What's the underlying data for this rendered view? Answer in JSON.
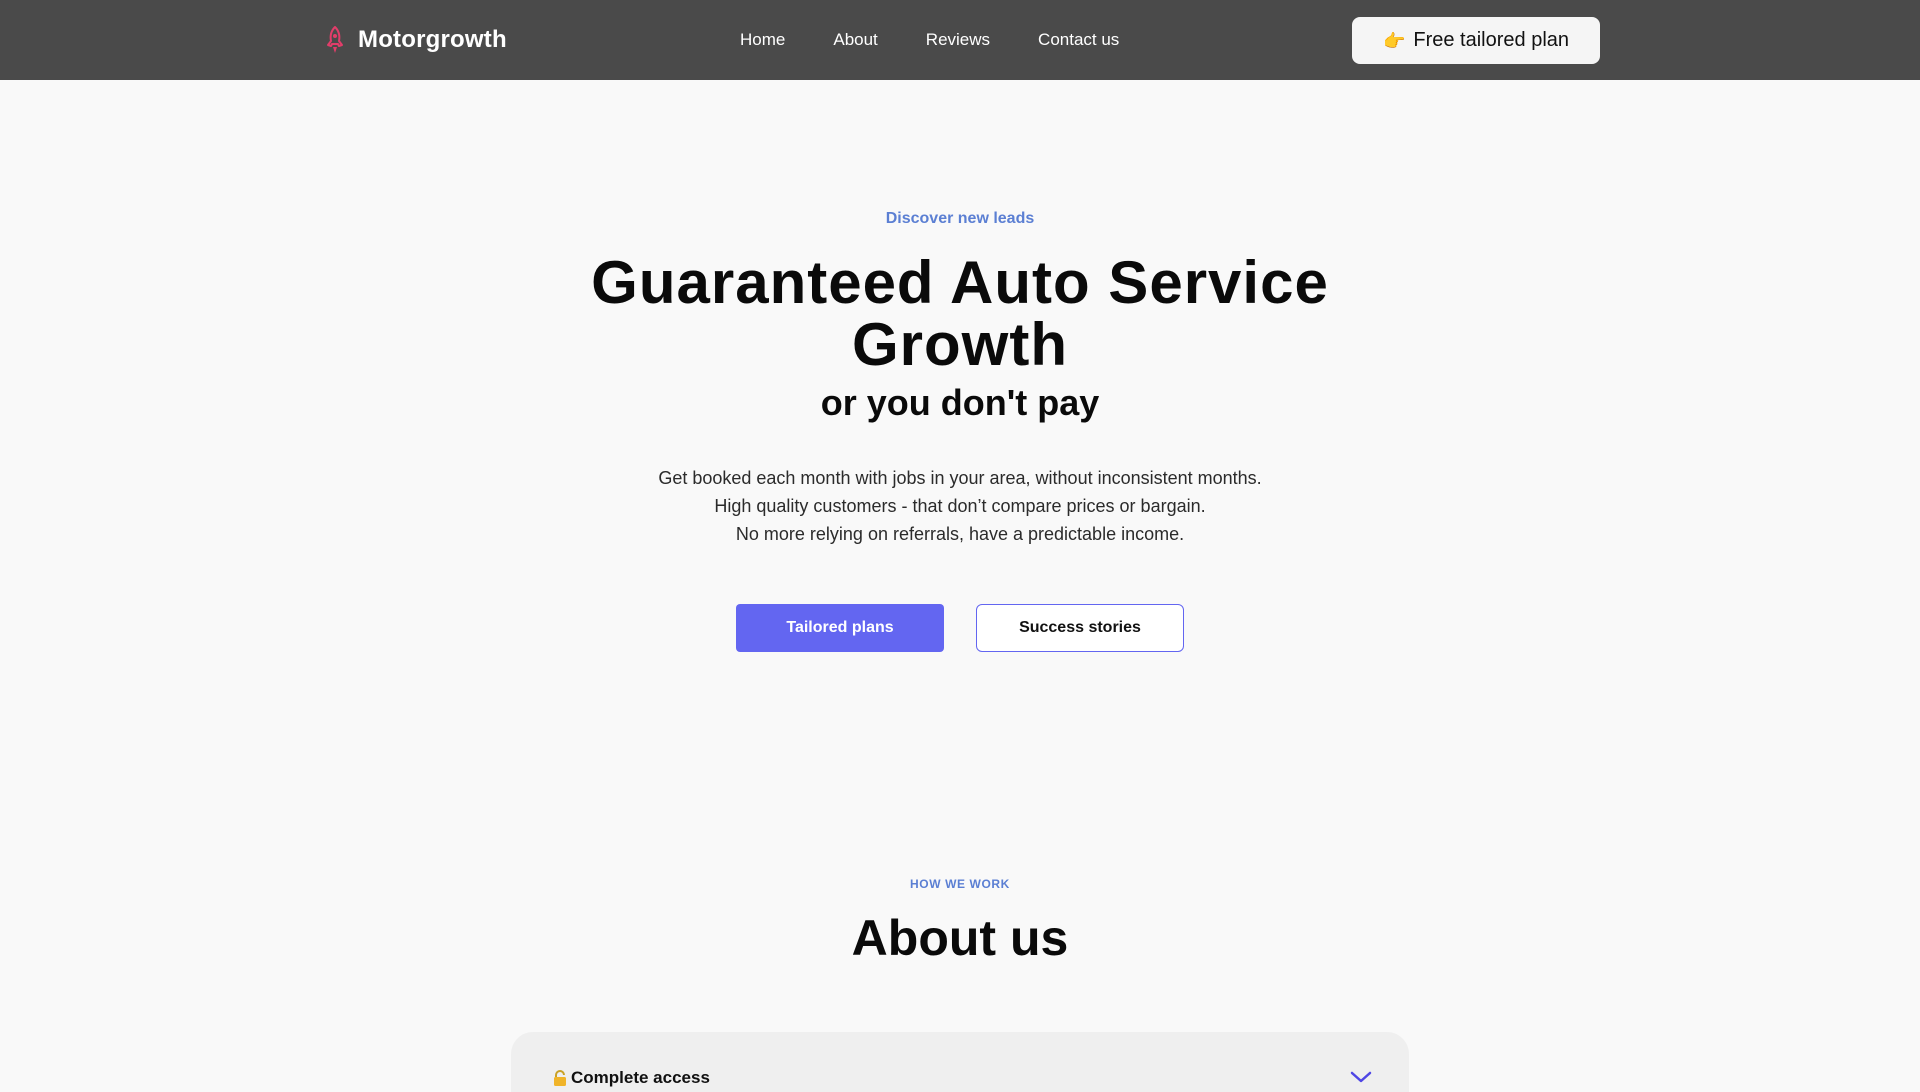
{
  "header": {
    "brand": {
      "name": "Motorgrowth",
      "icon": "rocket-icon",
      "icon_color": "#e23d6a"
    },
    "nav": [
      {
        "label": "Home"
      },
      {
        "label": "About"
      },
      {
        "label": "Reviews"
      },
      {
        "label": "Contact us"
      }
    ],
    "cta": {
      "icon": "pointing-hand-icon",
      "icon_glyph": "👉",
      "label": "Free tailored plan"
    },
    "background": "#4a4a4a"
  },
  "hero": {
    "eyebrow": "Discover new leads",
    "headline_line1": "Guaranteed Auto Service",
    "headline_line2": "Growth",
    "subhead": "or you don't pay",
    "description": [
      "Get booked each month with jobs in your area, without inconsistent months.",
      "High quality customers - that don’t compare prices or bargain.",
      "No more relying on referrals, have a predictable income."
    ],
    "primary_button": "Tailored plans",
    "secondary_button": "Success stories",
    "accent_color": "#6366f1",
    "eyebrow_color": "#5b7fd3"
  },
  "about": {
    "eyebrow": "HOW WE WORK",
    "title": "About us",
    "accordion": [
      {
        "icon": "lock-icon",
        "label": "Complete access",
        "expanded": false
      }
    ]
  }
}
